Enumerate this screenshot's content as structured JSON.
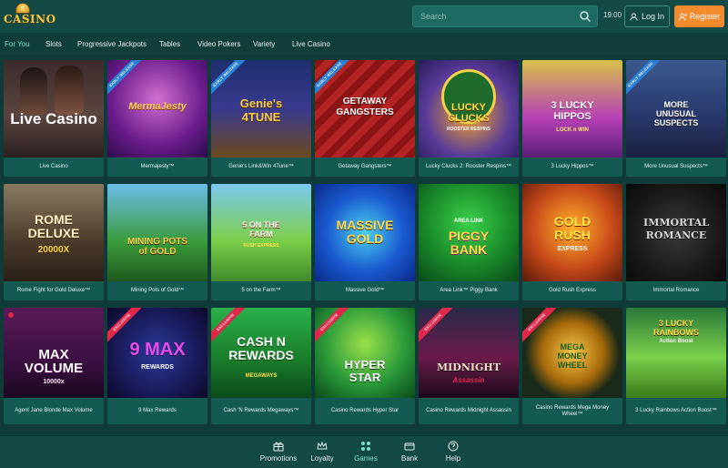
{
  "header": {
    "logo_text": "CASINO",
    "search_placeholder": "Search",
    "clock": "19:00",
    "login_label": "Log In",
    "register_label": "Register"
  },
  "categories": [
    {
      "label": "For You",
      "active": true
    },
    {
      "label": "Slots"
    },
    {
      "label": "Progressive Jackpots"
    },
    {
      "label": "Tables"
    },
    {
      "label": "Video Pokers"
    },
    {
      "label": "Variety"
    },
    {
      "label": "Live Casino"
    }
  ],
  "games": [
    {
      "name": "Live Casino",
      "art_title": "Live Casino"
    },
    {
      "name": "Mermajesty™",
      "art_title": "MermaJesty",
      "ribbon": "EARLY RELEASE"
    },
    {
      "name": "Genie's Link&Win 4Tune™",
      "art_title": "Genie's 4TUNE",
      "ribbon": "EARLY RELEASE"
    },
    {
      "name": "Getaway Gangsters™",
      "art_title": "GETAWAY GANGSTERS",
      "ribbon": "EARLY RELEASE"
    },
    {
      "name": "Lucky Clucks 2: Rooster Respins™",
      "art_title": "LUCKY CLUCKS",
      "art_sub": "ROOSTER RESPINS"
    },
    {
      "name": "3 Lucky Hippos™",
      "art_title": "3 LUCKY HIPPOS",
      "art_sub": "LOCK n WIN"
    },
    {
      "name": "More Unusual Suspects™",
      "art_title": "MORE UNUSUAL SUSPECTS",
      "ribbon": "EARLY RELEASE"
    },
    {
      "name": "Rome Fight for Gold Deluxe™",
      "art_title": "ROME DELUXE",
      "art_sub": "20000X"
    },
    {
      "name": "Mining Pots of Gold™",
      "art_title": "MINING POTS of GOLD"
    },
    {
      "name": "5 on the Farm™",
      "art_title": "5 ON THE FARM",
      "art_sub": "RUSH EXPRESS"
    },
    {
      "name": "Massive Gold™",
      "art_title": "MASSIVE GOLD"
    },
    {
      "name": "Area Link™ Piggy Bank",
      "art_title": "PIGGY BANK",
      "art_sub": "AREA LINK"
    },
    {
      "name": "Gold Rush Express",
      "art_title": "GOLD RUSH",
      "art_sub": "EXPRESS"
    },
    {
      "name": "Immortal Romance",
      "art_title": "IMMORTAL ROMANCE"
    },
    {
      "name": "Agent Jane Blonde Max Volume",
      "art_title": "MAX VOLUME",
      "art_sub": "10000x"
    },
    {
      "name": "9 Max Rewards",
      "art_title": "9 MAX",
      "art_sub": "REWARDS",
      "ribbon": "EXCLUSIVE"
    },
    {
      "name": "Cash 'N Rewards Megaways™",
      "art_title": "CASH N REWARDS",
      "art_sub": "MEGAWAYS",
      "ribbon": "EXCLUSIVE"
    },
    {
      "name": "Casino Rewards Hyper Star",
      "art_title": "HYPER STAR",
      "ribbon": "EXCLUSIVE"
    },
    {
      "name": "Casino Rewards Midnight Assassin",
      "art_title": "MIDNIGHT",
      "art_sub": "Assassin",
      "ribbon": "EXCLUSIVE"
    },
    {
      "name": "Casino Rewards Mega Money Wheel™",
      "art_title": "MEGA MONEY WHEEL",
      "ribbon": "EXCLUSIVE"
    },
    {
      "name": "3 Lucky Rainbows Action Boost™",
      "art_title": "3 LUCKY RAINBOWS",
      "art_sub": "Action Boost"
    }
  ],
  "bottom_nav": [
    {
      "label": "Promotions",
      "icon": "gift-icon"
    },
    {
      "label": "Loyalty",
      "icon": "crown-icon"
    },
    {
      "label": "Games",
      "icon": "games-icon",
      "active": true
    },
    {
      "label": "Bank",
      "icon": "wallet-icon"
    },
    {
      "label": "Help",
      "icon": "help-icon"
    }
  ],
  "colors": {
    "background": "#0f3c38",
    "header": "#134a45",
    "register": "#f28a2e",
    "active_tab": "#7be0c9",
    "ribbon_red": "#e0294a"
  }
}
